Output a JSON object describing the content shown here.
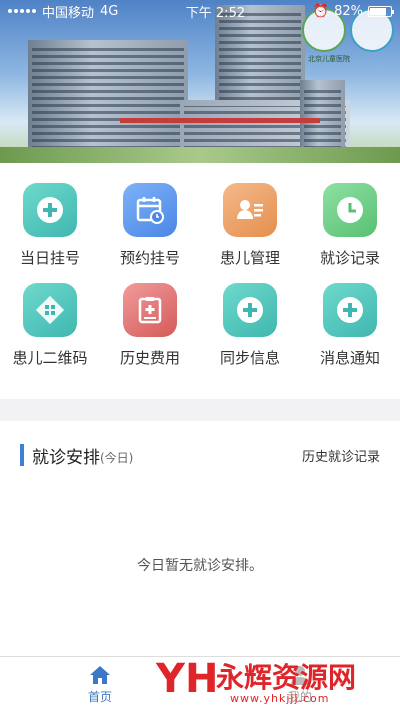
{
  "status_bar": {
    "carrier": "中国移动",
    "network": "4G",
    "time": "下午 2:52",
    "battery": "82%",
    "battery_level": 0.82
  },
  "banner": {
    "logo_text": "北京儿童医院"
  },
  "menu": [
    {
      "label": "当日挂号",
      "icon": "plus-icon",
      "color": "teal"
    },
    {
      "label": "预约挂号",
      "icon": "calendar-clock-icon",
      "color": "blue"
    },
    {
      "label": "患儿管理",
      "icon": "id-card-icon",
      "color": "orange"
    },
    {
      "label": "就诊记录",
      "icon": "clock-icon",
      "color": "green"
    },
    {
      "label": "患儿二维码",
      "icon": "qr-code-icon",
      "color": "teal"
    },
    {
      "label": "历史费用",
      "icon": "clipboard-plus-icon",
      "color": "red"
    },
    {
      "label": "同步信息",
      "icon": "plus-icon",
      "color": "teal"
    },
    {
      "label": "消息通知",
      "icon": "plus-icon",
      "color": "teal"
    }
  ],
  "schedule": {
    "title": "就诊安排",
    "subtitle": "(今日)",
    "history_link": "历史就诊记录",
    "empty_text": "今日暂无就诊安排。"
  },
  "tabbar": {
    "home_label": "首页",
    "mine_label": "我的"
  },
  "watermark": {
    "logo": "YH",
    "name": "永辉资源网",
    "url": "www.yhkjjj.com"
  },
  "colors": {
    "accent": "#3b78c8",
    "teal": "#3fb7b0",
    "blue": "#4c86e6",
    "orange": "#e58f4e",
    "green": "#58c072",
    "red": "#d55a5a"
  }
}
